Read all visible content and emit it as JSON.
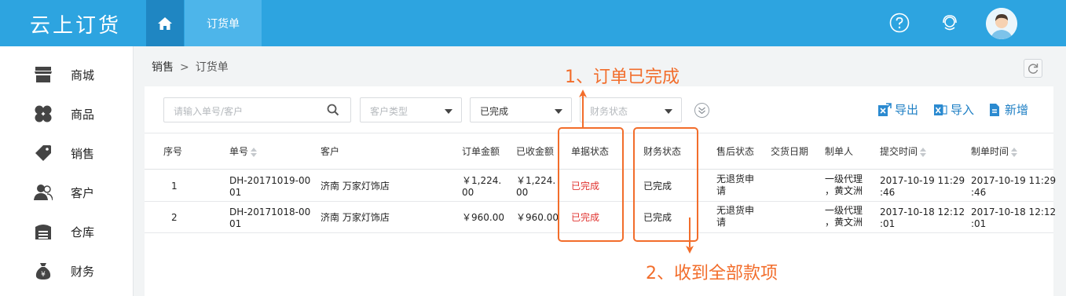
{
  "app": {
    "logo": "云上订货",
    "active_tab": "订货单"
  },
  "sidebar": {
    "items": [
      {
        "label": "商城",
        "icon": "store-icon"
      },
      {
        "label": "商品",
        "icon": "clover-icon"
      },
      {
        "label": "销售",
        "icon": "tag-icon"
      },
      {
        "label": "客户",
        "icon": "users-icon"
      },
      {
        "label": "仓库",
        "icon": "warehouse-icon"
      },
      {
        "label": "财务",
        "icon": "money-bag-icon"
      }
    ]
  },
  "breadcrumb": {
    "parent": "销售",
    "separator": ">",
    "current": "订货单"
  },
  "filters": {
    "search_placeholder": "请输入单号/客户",
    "customer_type_placeholder": "客户类型",
    "order_status_value": "已完成",
    "finance_status_placeholder": "财务状态"
  },
  "actions": {
    "export": "导出",
    "import": "导入",
    "add": "新增"
  },
  "table": {
    "headers": {
      "index": "序号",
      "order_no": "单号",
      "customer": "客户",
      "order_amount": "订单金额",
      "received_amount": "已收金额",
      "doc_status": "单据状态",
      "finance_status": "财务状态",
      "after_sale": "售后状态",
      "delivery_date": "交货日期",
      "creator": "制单人",
      "submit_time": "提交时间",
      "create_time": "制单时间"
    },
    "rows": [
      {
        "index": "1",
        "order_no_1": "DH-20171019-00",
        "order_no_2": "01",
        "customer": "济南 万家灯饰店",
        "order_amount_1": "￥1,224.",
        "order_amount_2": "00",
        "received_1": "￥1,224.",
        "received_2": "00",
        "doc_status": "已完成",
        "finance_status": "已完成",
        "after_sale_1": "无退货申",
        "after_sale_2": "请",
        "creator_1": "一级代理",
        "creator_2": "，黄文洲",
        "submit_1": "2017-10-19 11:29",
        "submit_2": ":46",
        "create_1": "2017-10-19 11:29",
        "create_2": ":46"
      },
      {
        "index": "2",
        "order_no_1": "DH-20171018-00",
        "order_no_2": "01",
        "customer": "济南 万家灯饰店",
        "order_amount_1": "￥960.00",
        "order_amount_2": "",
        "received_1": "￥960.00",
        "received_2": "",
        "doc_status": "已完成",
        "finance_status": "已完成",
        "after_sale_1": "无退货申",
        "after_sale_2": "请",
        "creator_1": "一级代理",
        "creator_2": "，黄文洲",
        "submit_1": "2017-10-18 12:12",
        "submit_2": ":01",
        "create_1": "2017-10-18 12:12",
        "create_2": ":01"
      }
    ]
  },
  "annotations": {
    "note_1": "1、订单已完成",
    "note_2": "2、收到全部款项"
  },
  "colors": {
    "topbar": "#2da4e0",
    "accent": "#1e7fc4",
    "annotation": "#f26d2b",
    "status_red": "#e0332f"
  }
}
